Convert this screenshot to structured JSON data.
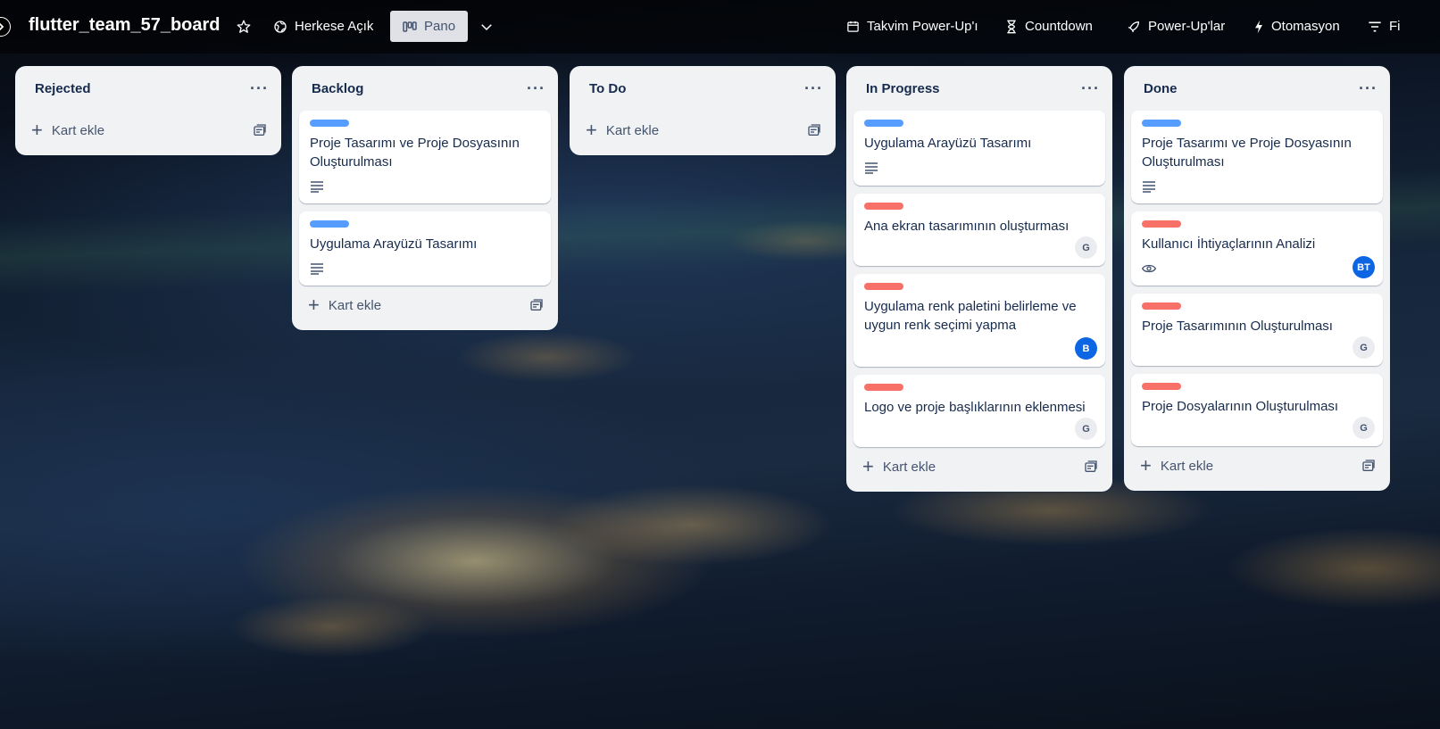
{
  "header": {
    "board_title": "flutter_team_57_board",
    "visibility": "Herkese Açık",
    "view": "Pano",
    "buttons": [
      {
        "label": "Takvim Power-Up'ı",
        "icon": "calendar-icon"
      },
      {
        "label": "Countdown",
        "icon": "hourglass-icon"
      },
      {
        "label": "Power-Up'lar",
        "icon": "rocket-icon"
      },
      {
        "label": "Otomasyon",
        "icon": "lightning-icon"
      },
      {
        "label": "Fi",
        "icon": "filter-icon"
      }
    ]
  },
  "add_card_label": "Kart ekle",
  "colors": {
    "blue_label": "#579dff",
    "red_label": "#f87168",
    "avatar_blue": "#0c66e4"
  },
  "lists": [
    {
      "title": "Rejected",
      "cards": []
    },
    {
      "title": "Backlog",
      "cards": [
        {
          "title": "Proje Tasarımı ve Proje Dosyasının Oluşturulması",
          "label": "blue",
          "badge": "description"
        },
        {
          "title": "Uygulama Arayüzü Tasarımı",
          "label": "blue",
          "badge": "description"
        }
      ]
    },
    {
      "title": "To Do",
      "cards": []
    },
    {
      "title": "In Progress",
      "cards": [
        {
          "title": "Uygulama Arayüzü Tasarımı",
          "label": "blue",
          "badge": "description"
        },
        {
          "title": "Ana ekran tasarımının oluşturması",
          "label": "red",
          "avatar": "G"
        },
        {
          "title": "Uygulama renk paletini belirleme ve uygun renk seçimi yapma",
          "label": "red",
          "avatar": "B"
        },
        {
          "title": "Logo ve proje başlıklarının eklenmesi",
          "label": "red",
          "avatar": "G"
        }
      ]
    },
    {
      "title": "Done",
      "cards": [
        {
          "title": "Proje Tasarımı ve Proje Dosyasının Oluşturulması",
          "label": "blue",
          "badge": "description"
        },
        {
          "title": "Kullanıcı İhtiyaçlarının Analizi",
          "label": "red",
          "badge": "watch",
          "avatar": "BT"
        },
        {
          "title": "Proje Tasarımının Oluşturulması",
          "label": "red",
          "avatar": "G"
        },
        {
          "title": "Proje Dosyalarının Oluşturulması",
          "label": "red",
          "avatar": "G"
        }
      ]
    }
  ]
}
